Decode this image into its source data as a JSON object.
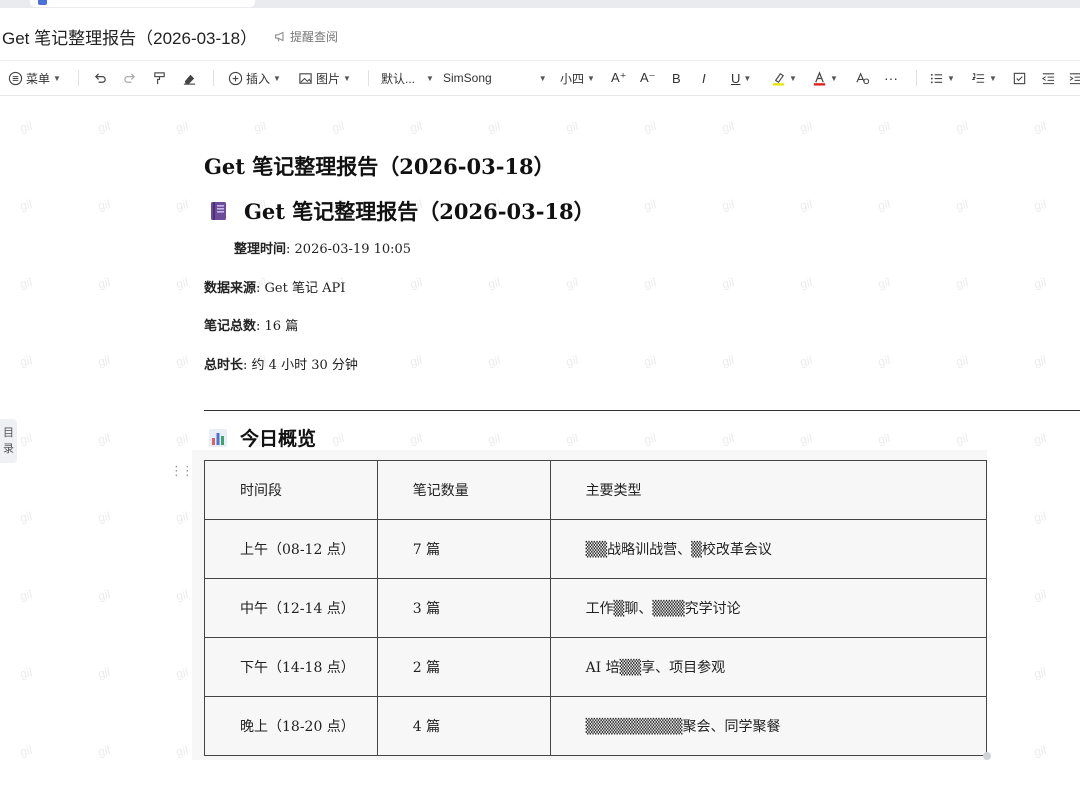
{
  "window": {
    "title": "Get 笔记整理报告（2026-03-18）",
    "remind_label": "提醒查阅"
  },
  "toolbar": {
    "menu": "菜单",
    "insert": "插入",
    "image": "图片",
    "style": "默认...",
    "font": "SimSong",
    "size": "小四"
  },
  "sidebar": {
    "toc": [
      "目",
      "录"
    ]
  },
  "document": {
    "title": "Get  笔记整理报告（2026-03-18）",
    "heading": "Get  笔记整理报告（2026-03-18）",
    "heading_icon": "book-icon",
    "meta": [
      {
        "label": "整理时间",
        "value": ": 2026-03-19 10:05"
      },
      {
        "label": "数据来源",
        "value": ": Get  笔记  API"
      },
      {
        "label": "笔记总数",
        "value": ": 16  篇"
      },
      {
        "label": "总时长",
        "value": ":  约  4  小时  30  分钟"
      }
    ],
    "section_title": "今日概览",
    "section_icon": "bar-chart-icon",
    "table": {
      "headers": [
        "时间段",
        "笔记数量",
        "主要类型"
      ],
      "rows": [
        [
          "上午（08-12  点）",
          "7  篇",
          "▒▒战略训战营、▒校改革会议"
        ],
        [
          "中午（12-14  点）",
          "3  篇",
          "工作▒聊、▒▒▒究学讨论"
        ],
        [
          "下午（14-18  点）",
          "2  篇",
          "AI  培▒▒享、项目参观"
        ],
        [
          "晚上（18-20  点）",
          "4  篇",
          "▒▒▒▒▒▒▒▒▒聚会、同学聚餐"
        ]
      ]
    }
  },
  "watermark": "gil",
  "colors": {
    "highlight": "#e6e600",
    "font_color": "#e02020",
    "accent": "#4a72d8"
  }
}
